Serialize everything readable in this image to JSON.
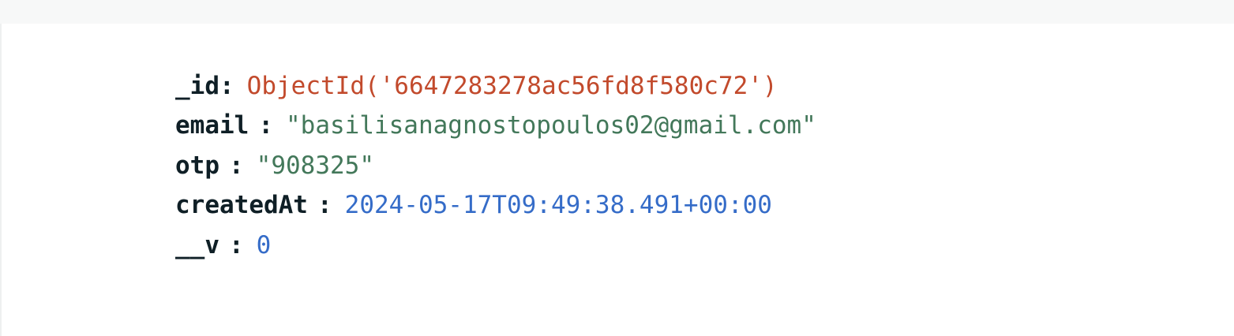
{
  "document": {
    "fields": [
      {
        "key": "_id",
        "separator": ":",
        "value": "ObjectId('6647283278ac56fd8f580c72')",
        "value_type": "objectid",
        "value_color": "#c24a2c"
      },
      {
        "key": "email",
        "separator": ":",
        "value": "\"basilisanagnostopoulos02@gmail.com\"",
        "value_type": "string",
        "value_color": "#43785a"
      },
      {
        "key": "otp",
        "separator": ":",
        "value": "\"908325\"",
        "value_type": "string",
        "value_color": "#43785a"
      },
      {
        "key": "createdAt",
        "separator": ":",
        "value": "2024-05-17T09:49:38.491+00:00",
        "value_type": "date",
        "value_color": "#356cc8"
      },
      {
        "key": "__v",
        "separator": ":",
        "value": "0",
        "value_type": "number",
        "value_color": "#356cc8"
      }
    ]
  },
  "colors": {
    "key": "#0f1f26",
    "background": "#ffffff",
    "top_strip": "#f7f8f8"
  }
}
